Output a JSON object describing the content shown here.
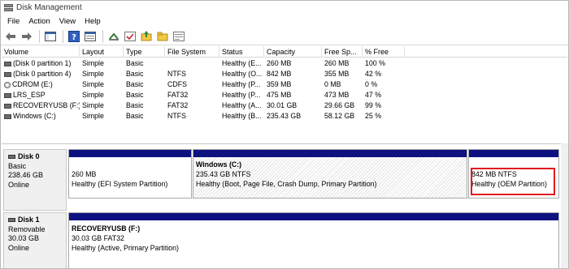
{
  "window": {
    "title": "Disk Management"
  },
  "menu": [
    "File",
    "Action",
    "View",
    "Help"
  ],
  "toolbar_icons": [
    "back-arrow-icon",
    "forward-arrow-icon",
    "show-hide-console-tree-icon",
    "help-icon",
    "properties-icon",
    "rescan-icon",
    "check-icon",
    "folder-up-icon",
    "new-folder-icon",
    "more-icon"
  ],
  "volume_table": {
    "headers": [
      "Volume",
      "Layout",
      "Type",
      "File System",
      "Status",
      "Capacity",
      "Free Sp...",
      "% Free"
    ],
    "rows": [
      [
        "(Disk 0 partition 1)",
        "Simple",
        "Basic",
        "",
        "Healthy (E...",
        "260 MB",
        "260 MB",
        "100 %"
      ],
      [
        "(Disk 0 partition 4)",
        "Simple",
        "Basic",
        "NTFS",
        "Healthy (O...",
        "842 MB",
        "355 MB",
        "42 %"
      ],
      [
        "CDROM (E:)",
        "Simple",
        "Basic",
        "CDFS",
        "Healthy (P...",
        "359 MB",
        "0 MB",
        "0 %"
      ],
      [
        "LRS_ESP",
        "Simple",
        "Basic",
        "FAT32",
        "Healthy (P...",
        "475 MB",
        "473 MB",
        "47 %"
      ],
      [
        "RECOVERYUSB (F:)",
        "Simple",
        "Basic",
        "FAT32",
        "Healthy (A...",
        "30.01 GB",
        "29.66 GB",
        "99 %"
      ],
      [
        "Windows (C:)",
        "Simple",
        "Basic",
        "NTFS",
        "Healthy (B...",
        "235.43 GB",
        "58.12 GB",
        "25 %"
      ]
    ],
    "row_icons": [
      "drive",
      "drive",
      "cdrom",
      "drive",
      "drive",
      "drive"
    ]
  },
  "disks": [
    {
      "name": "Disk 0",
      "type": "Basic",
      "size": "238.46 GB",
      "status": "Online",
      "partitions": [
        {
          "name": "",
          "line1": "260 MB",
          "line2": "Healthy (EFI System Partition)"
        },
        {
          "name": "Windows  (C:)",
          "line1": "235.43 GB NTFS",
          "line2": "Healthy (Boot, Page File, Crash Dump, Primary Partition)"
        },
        {
          "name": "",
          "line1": "842 MB NTFS",
          "line2": "Healthy (OEM Partition)"
        }
      ]
    },
    {
      "name": "Disk 1",
      "type": "Removable",
      "size": "30.03 GB",
      "status": "Online",
      "partitions": [
        {
          "name": "RECOVERYUSB  (F:)",
          "line1": "30.03 GB FAT32",
          "line2": "Healthy (Active, Primary Partition)"
        }
      ]
    }
  ],
  "colors": {
    "partition_bar": "#0e1180",
    "highlight": "#e0191f"
  }
}
